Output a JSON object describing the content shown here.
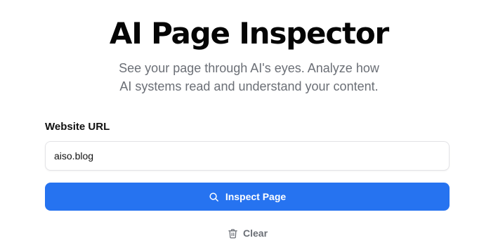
{
  "header": {
    "title": "AI Page Inspector",
    "subtitle_line1": "See your page through AI's eyes. Analyze how",
    "subtitle_line2": "AI systems read and understand your content."
  },
  "form": {
    "url_label": "Website URL",
    "url_value": "aiso.blog",
    "inspect_label": "Inspect Page",
    "inspect_icon": "search-icon",
    "clear_label": "Clear",
    "clear_icon": "trash-icon"
  },
  "colors": {
    "primary_button": "#2673f0",
    "subtitle_text": "#6b6f76"
  }
}
